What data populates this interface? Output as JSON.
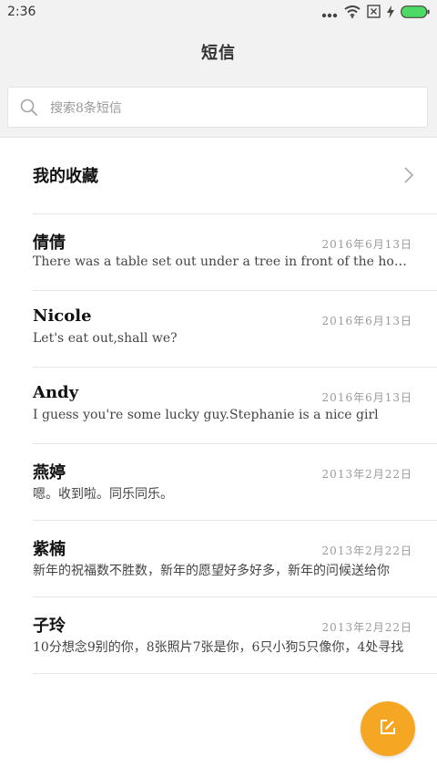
{
  "status_bar": {
    "time": "2:36"
  },
  "header": {
    "title": "短信"
  },
  "search": {
    "placeholder": "搜索8条短信"
  },
  "favorites": {
    "label": "我的收藏"
  },
  "conversations": [
    {
      "name": "倩倩",
      "date": "2016年6月13日",
      "preview": "There was a table set out under a tree in front of the house"
    },
    {
      "name": "Nicole",
      "date": "2016年6月13日",
      "preview": "Let's eat out,shall we?"
    },
    {
      "name": "Andy",
      "date": "2016年6月13日",
      "preview": "I guess you're some lucky guy.Stephanie is a nice girl"
    },
    {
      "name": "燕婷",
      "date": "2013年2月22日",
      "preview": "嗯。收到啦。同乐同乐。"
    },
    {
      "name": "紫楠",
      "date": "2013年2月22日",
      "preview": "新年的祝福数不胜数，新年的愿望好多好多，新年的问候送给你"
    },
    {
      "name": "子玲",
      "date": "2013年2月22日",
      "preview": "10分想念9别的你，8张照片7张是你，6只小狗5只像你，4处寻找"
    }
  ],
  "colors": {
    "accent": "#f5a623",
    "battery": "#4cd964",
    "background": "#f2f2f2"
  },
  "icons": {
    "search": "search-icon",
    "chevron": "chevron-right-icon",
    "compose": "compose-icon",
    "signal": "signal-dots-icon",
    "wifi": "wifi-icon",
    "sim": "no-sim-icon",
    "charging": "charging-bolt-icon",
    "battery": "battery-icon"
  }
}
